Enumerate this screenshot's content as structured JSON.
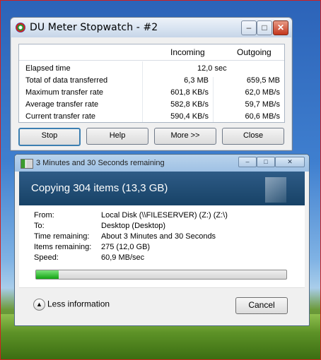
{
  "du_meter": {
    "title": "DU Meter Stopwatch - #2",
    "columns": {
      "incoming": "Incoming",
      "outgoing": "Outgoing"
    },
    "rows": [
      {
        "label": "Elapsed time",
        "merged": "12,0 sec"
      },
      {
        "label": "Total of data transferred",
        "incoming": "6,3 MB",
        "outgoing": "659,5 MB"
      },
      {
        "label": "Maximum transfer rate",
        "incoming": "601,8 KB/s",
        "outgoing": "62,0 MB/s"
      },
      {
        "label": "Average transfer rate",
        "incoming": "582,8 KB/s",
        "outgoing": "59,7 MB/s"
      },
      {
        "label": "Current transfer rate",
        "incoming": "590,4 KB/s",
        "outgoing": "60,6 MB/s"
      }
    ],
    "buttons": {
      "stop": "Stop",
      "help": "Help",
      "more": "More >>",
      "close": "Close"
    }
  },
  "copy_dialog": {
    "title": "3 Minutes and 30 Seconds remaining",
    "header": "Copying 304 items (13,3 GB)",
    "info": [
      {
        "label": "From:",
        "value": "Local Disk (\\\\FILESERVER) (Z:) (Z:\\)"
      },
      {
        "label": "To:",
        "value": "Desktop (Desktop)"
      },
      {
        "label": "Time remaining:",
        "value": "About 3 Minutes and 30 Seconds"
      },
      {
        "label": "Items remaining:",
        "value": "275 (12,0 GB)"
      },
      {
        "label": "Speed:",
        "value": "60,9 MB/sec"
      }
    ],
    "progress_fraction": 0.09,
    "less_info": "Less information",
    "cancel": "Cancel"
  },
  "icons": [
    "du-meter-icon",
    "minimize-icon",
    "maximize-icon",
    "close-icon",
    "copy-icon",
    "chevron-up-icon"
  ]
}
